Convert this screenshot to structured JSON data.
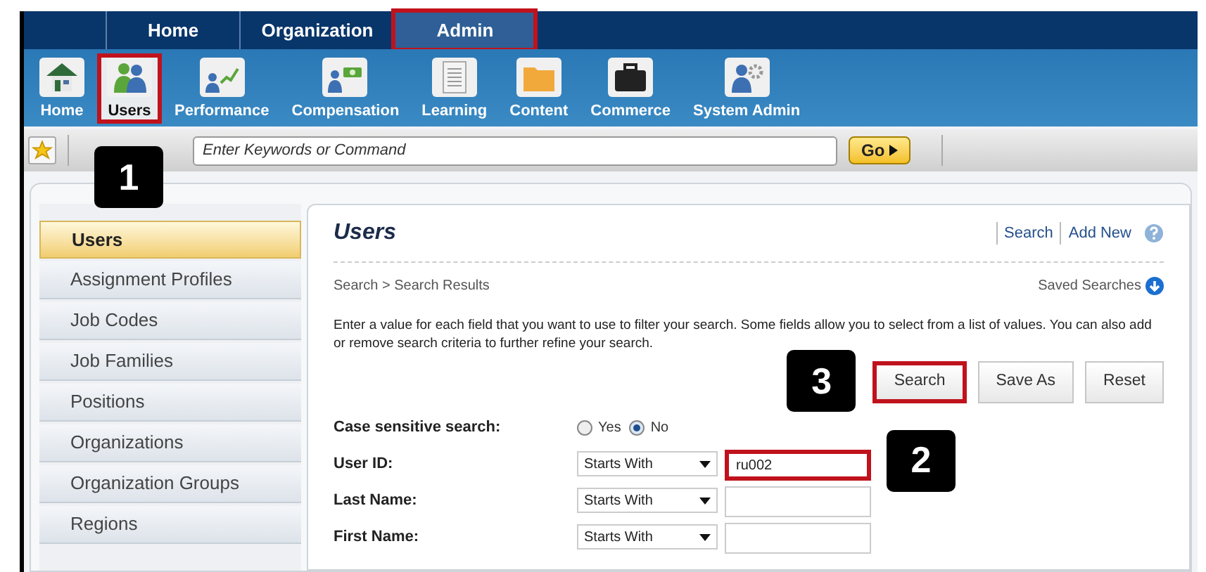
{
  "nav_tabs": [
    {
      "label": "Home",
      "selected": false,
      "highlighted": false
    },
    {
      "label": "Organization",
      "selected": false,
      "highlighted": false
    },
    {
      "label": "Admin",
      "selected": true,
      "highlighted": true
    }
  ],
  "modules": [
    {
      "label": "Home",
      "selected": false,
      "highlighted": false
    },
    {
      "label": "Users",
      "selected": true,
      "highlighted": true,
      "callout": "1"
    },
    {
      "label": "Performance",
      "selected": false,
      "highlighted": false
    },
    {
      "label": "Compensation",
      "selected": false,
      "highlighted": false
    },
    {
      "label": "Learning",
      "selected": false,
      "highlighted": false
    },
    {
      "label": "Content",
      "selected": false,
      "highlighted": false
    },
    {
      "label": "Commerce",
      "selected": false,
      "highlighted": false
    },
    {
      "label": "System Admin",
      "selected": false,
      "highlighted": false
    }
  ],
  "search": {
    "placeholder": "Enter Keywords or Command",
    "button": "Go"
  },
  "sidebar": {
    "items": [
      {
        "label": "Users",
        "selected": true
      },
      {
        "label": "Assignment Profiles",
        "selected": false
      },
      {
        "label": "Job Codes",
        "selected": false
      },
      {
        "label": "Job Families",
        "selected": false
      },
      {
        "label": "Positions",
        "selected": false
      },
      {
        "label": "Organizations",
        "selected": false
      },
      {
        "label": "Organization Groups",
        "selected": false
      },
      {
        "label": "Regions",
        "selected": false
      }
    ]
  },
  "panel": {
    "title": "Users",
    "links": [
      "Search",
      "Add New"
    ],
    "breadcrumb": "Search > Search Results",
    "saved_searches": "Saved Searches",
    "instructions": "Enter a value for each field that you want to use to filter your search. Some fields allow you to select from a list of values. You can also add or remove search criteria to further refine your search.",
    "buttons": [
      {
        "label": "Search",
        "highlighted": true,
        "callout": "3"
      },
      {
        "label": "Save As",
        "highlighted": false
      },
      {
        "label": "Reset",
        "highlighted": false
      }
    ],
    "fields": [
      {
        "kind": "radio",
        "label": "Case sensitive search:",
        "options": [
          {
            "label": "Yes",
            "selected": false
          },
          {
            "label": "No",
            "selected": true
          }
        ]
      },
      {
        "kind": "text",
        "label": "User ID:",
        "operator": "Starts With",
        "value": "ru002",
        "highlighted": true,
        "callout": "2"
      },
      {
        "kind": "text",
        "label": "Last Name:",
        "operator": "Starts With",
        "highlighted": false
      },
      {
        "kind": "text",
        "label": "First Name:",
        "operator": "Starts With",
        "highlighted": false
      }
    ]
  }
}
